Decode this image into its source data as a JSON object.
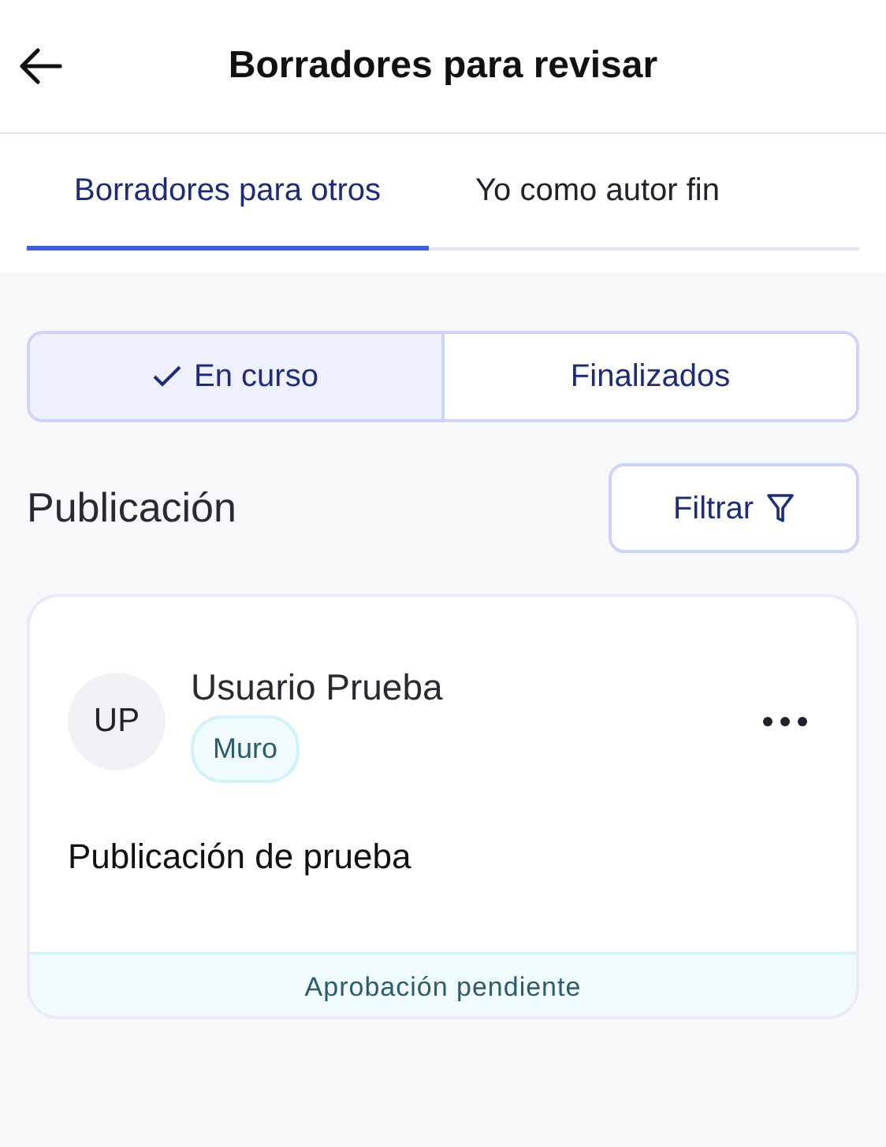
{
  "header": {
    "title": "Borradores para revisar"
  },
  "tabs": [
    {
      "label": "Borradores para otros",
      "selected": true
    },
    {
      "label": "Yo como autor fin",
      "selected": false
    }
  ],
  "segments": [
    {
      "label": "En curso",
      "selected": true
    },
    {
      "label": "Finalizados",
      "selected": false
    }
  ],
  "section": {
    "title": "Publicación",
    "filter_button": "Filtrar"
  },
  "posts": [
    {
      "initials": "UP",
      "author": "Usuario Prueba",
      "tag": "Muro",
      "text": "Publicación de prueba",
      "status": "Aprobación pendiente"
    }
  ]
}
